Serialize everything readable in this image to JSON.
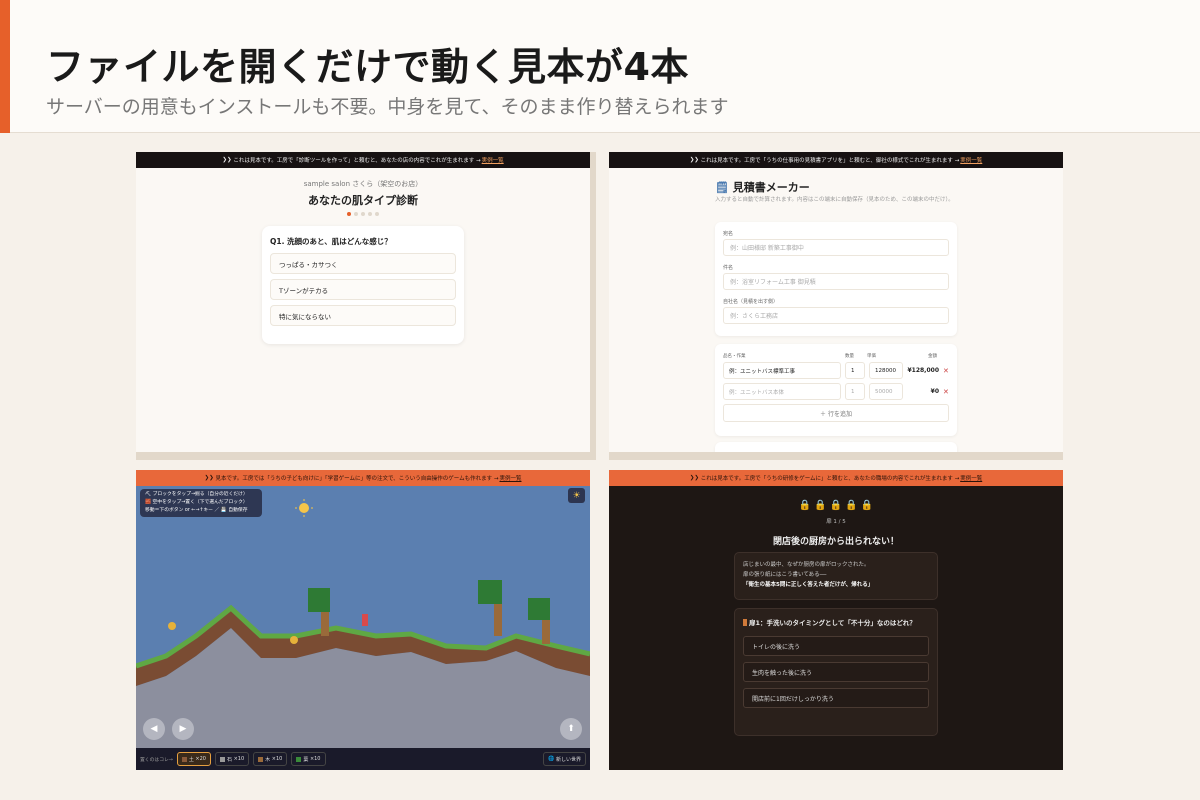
{
  "header": {
    "title": "ファイルを開くだけで動く見本が4本",
    "subtitle": "サーバーの用意もインストールも不要。中身を見て、そのまま作り替えられます"
  },
  "colors": {
    "accent": "#e6602a",
    "orange_banner": "#e8683a",
    "dark_banner": "#171212"
  },
  "panel1": {
    "banner_text": "これは見本です。工房で「診断ツールを作って」と頼むと、あなたの店の内容でこれが生まれます →",
    "banner_link": "実例一覧",
    "brand": "sample salon さくら（架空のお店）",
    "title": "あなたの肌タイプ診断",
    "question": "Q1. 洗顔のあと、肌はどんな感じ？",
    "options": [
      "つっぱる・カサつく",
      "Tゾーンがテカる",
      "特に気にならない"
    ]
  },
  "panel2": {
    "banner_text": "これは見本です。工房で「うちの仕事用の見積書アプリを」と頼むと、御社の様式でこれが生まれます →",
    "banner_link": "実例一覧",
    "title": "見積書メーカー",
    "description": "入力すると自動で計算されます。内容はこの端末に自動保存（見本のため、この端末の中だけ）。",
    "fields": [
      {
        "label": "宛名",
        "placeholder": "例：山田様邸 新築工事御中"
      },
      {
        "label": "件名",
        "placeholder": "例：浴室リフォーム工事 御見積"
      },
      {
        "label": "自社名（見積を出す側）",
        "placeholder": "例：さくら工務店"
      }
    ],
    "table_headers": [
      "品名・作業",
      "数量",
      "単価",
      "金額"
    ],
    "rows": [
      {
        "item": "例：ユニットバス標準工事",
        "qty": "1",
        "price": "128000",
        "amount": "¥128,000"
      },
      {
        "item": "例：ユニットバス本体",
        "qty": "1",
        "price": "50000",
        "amount": "¥0"
      }
    ],
    "add_row": "＋ 行を追加"
  },
  "panel3": {
    "banner_text": "見本です。工房では「うちの子ども向けに」「学習ゲームに」等の注文で、こういう自由操作のゲームも作れます →",
    "banner_link": "実例一覧",
    "help_lines": [
      "⛏ ブロックをタップ→掘る（自分の近くだけ）",
      "🧱 空中をタップ→置く（下で選んだブロック）",
      "移動＝下のボタン or ←→↑キー ／ 💾 自動保存"
    ],
    "toolbar_label": "置くのはコレ→",
    "blocks": [
      {
        "label": "土",
        "count": "×20",
        "color": "#8a5a3a",
        "selected": true
      },
      {
        "label": "石",
        "count": "×10",
        "color": "#999999",
        "selected": false
      },
      {
        "label": "木",
        "count": "×10",
        "color": "#9a6a3a",
        "selected": false
      },
      {
        "label": "葉",
        "count": "×10",
        "color": "#3a8a3a",
        "selected": false
      }
    ],
    "new_world": "新しい世界"
  },
  "panel4": {
    "banner_text": "これは見本です。工房で「うちの研修をゲームに」と頼むと、あなたの職場の内容でこれが生まれます →",
    "banner_link": "実例一覧",
    "door_counter": "扉 1 / 5",
    "title": "閉店後の厨房から出られない！",
    "story_lines": [
      "店じまいの最中、なぜか厨房の扉がロックされた。",
      "扉の張り紙にはこう書いてある──"
    ],
    "story_emphasis": "「衛生の基本5問に正しく答えた者だけが、帰れる」",
    "question": "扉1：手洗いのタイミングとして「不十分」なのはどれ？",
    "options": [
      "トイレの後に洗う",
      "生肉を触った後に洗う",
      "開店前に1回だけしっかり洗う"
    ]
  }
}
